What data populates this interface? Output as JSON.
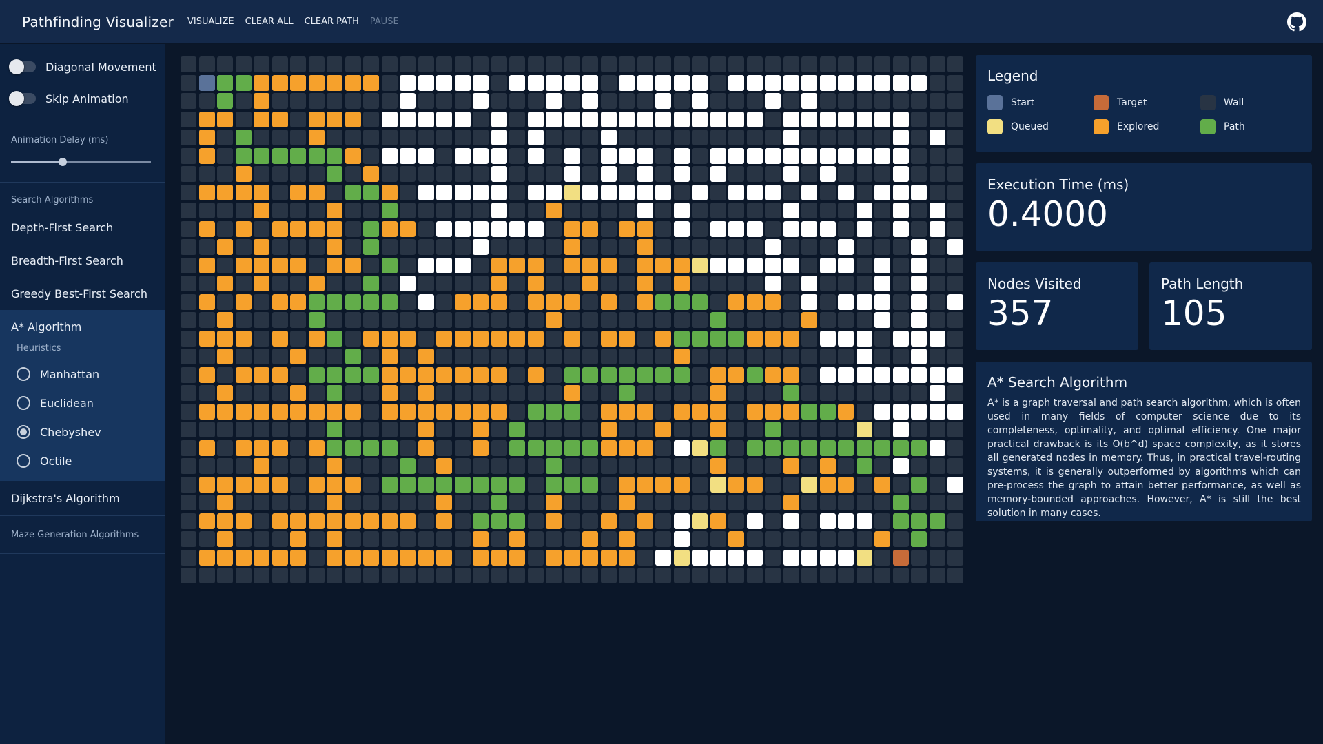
{
  "navbar": {
    "title": "Pathfinding Visualizer",
    "links": [
      "VISUALIZE",
      "CLEAR ALL",
      "CLEAR PATH",
      "PAUSE"
    ]
  },
  "sidebar": {
    "toggles": [
      {
        "label": "Diagonal Movement",
        "on": false
      },
      {
        "label": "Skip Animation",
        "on": false
      }
    ],
    "animation_delay_label": "Animation Delay (ms)",
    "animation_delay_fraction": 0.37,
    "search_algorithms_label": "Search Algorithms",
    "algorithms": [
      "Depth-First Search",
      "Breadth-First Search",
      "Greedy Best-First Search"
    ],
    "astar_label": "A* Algorithm",
    "heuristics_label": "Heuristics",
    "heuristics": [
      "Manhattan",
      "Euclidean",
      "Chebyshev",
      "Octile"
    ],
    "selected_heuristic": "Chebyshev",
    "dijkstra_label": "Dijkstra's Algorithm",
    "maze_label": "Maze Generation Algorithms"
  },
  "legend": {
    "title": "Legend",
    "items": [
      {
        "label": "Start",
        "color": "#5a7299"
      },
      {
        "label": "Target",
        "color": "#c66b39"
      },
      {
        "label": "Wall",
        "color": "#283444"
      },
      {
        "label": "Queued",
        "color": "#f2df82"
      },
      {
        "label": "Explored",
        "color": "#f6a12c"
      },
      {
        "label": "Path",
        "color": "#62ad4a"
      }
    ]
  },
  "stats": {
    "execution_label": "Execution Time (ms)",
    "execution_value": "0.4000",
    "nodes_label": "Nodes Visited",
    "nodes_value": "357",
    "path_label": "Path Length",
    "path_value": "105"
  },
  "description": {
    "title": "A* Search Algorithm",
    "text": "A* is a graph traversal and path search algorithm, which is often used in many fields of computer science due to its completeness, optimality, and optimal efficiency. One major practical drawback is its O(b^d) space complexity, as it stores all generated nodes in memory. Thus, in practical travel-routing systems, it is generally outperformed by algorithms which can pre-process the graph to attain better performance, as well as memory-bounded approaches. However, A* is still the best solution in many cases."
  },
  "grid": {
    "legend_key": "S=start T=target W=white . =dark E=explored P=path Q=queued",
    "rows": [
      "...........................................",
      ".SPPEEEEEEE.WWWWW.WWWWW.WWWWW.WWWWWWWWWWW.",
      "..P.E.......W...W...W.W...W.W...W.W.......",
      ".EE.EE.EEE.WWWWW.W.WWWWWWWWWWWWW.WWWWWWW.",
      ".E.P...E.........W.W...W.........W.....W.W.",
      ".E.PPPPPPE.WWW.WWW.W.W.WWW.W.WWWWWWWWWWW.",
      "...E....P.E......W...W.W.W.W.W...W.W...W.",
      ".EEEE.EE.PPE.WWWWW.WWQWWWWW.W.WWW.W.W.WWW.",
      "....E...E..P.....W..E....W.W.....W...W.W.W.",
      ".E.E.EEEE.PEE.WWWWWW.EE.EE.W.WWW.WWW.W.W.W.",
      "..E.E...E.P.....W....E...E......W...W...W.W",
      ".E.EEEE.EE.P.WWW.EEE.EEE.EEEQWWWWW.WW.W.W.",
      "..E.E..E..P.W....E.E..E..E.E....W.W...W.W..",
      ".E.E.EEPPPPP.W.EEE.EEE.E.EPPP.EEE.W.WWW.W.W",
      "..E....P............E........P....E...W.W..",
      ".EEE.E.EP.EEE.EEEEEE.E.EE.EPPPPEEE.WWW.WWW.",
      "..E...E..P.E.E.............E.........W..W..",
      ".E.EEE.PPPPEEEEEEE.E.PPPPPPP.EEPEE.WWWWWWWWW",
      "..E...E.P..E.E.......E..P....E...P.......W..",
      ".EEEEEEEEE.EEEEEEE.PPP.EEE.EEE.EEEPPE.WWWWW",
      "........P....E..E.P....E..E..E..P....Q.W.",
      ".E.EEE.EPPPP.E..E.PPPPPEEE.WQP.PPPPPPPPPPW.",
      "....E...E...P.E.....P........E...E.E.P.W.",
      ".EEEEE.EEE.PPPPPPPP.PPP.EEEE.QEE..QEE.E.P.W.",
      "..E.....E.....E..P..E...E........E.....P..",
      ".EEE.EEEEEEEE.E.PPP.E..E.E.WQE.W.W.WWW.PPP",
      "..E...E.E.......E.E...E.E..W..E.......E.P.",
      ".EEEEEE.EEEEEEE.EEE.EEEEE.WQWWWW.WWWWQ.T.",
      "..........................................."
    ]
  }
}
